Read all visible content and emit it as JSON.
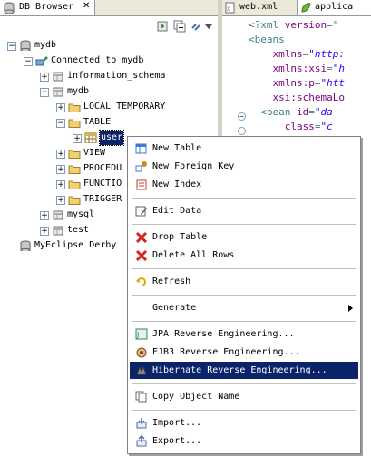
{
  "view": {
    "title": "DB Browser",
    "close_glyph": "✕"
  },
  "tree": [
    {
      "label": "mydb",
      "indent": 0,
      "icon": "database-icon",
      "expander": "−"
    },
    {
      "label": "Connected to mydb",
      "indent": 1,
      "icon": "connection-icon",
      "expander": "−"
    },
    {
      "label": "information_schema",
      "indent": 2,
      "icon": "schema-icon",
      "expander": "+"
    },
    {
      "label": "mydb",
      "indent": 2,
      "icon": "schema-icon",
      "expander": "−"
    },
    {
      "label": "LOCAL TEMPORARY",
      "indent": 3,
      "icon": "folder-icon",
      "expander": "+"
    },
    {
      "label": "TABLE",
      "indent": 3,
      "icon": "folder-icon",
      "expander": "−"
    },
    {
      "label": "user",
      "indent": 4,
      "icon": "table-icon",
      "expander": "+",
      "selected": true
    },
    {
      "label": "VIEW",
      "indent": 3,
      "icon": "folder-icon",
      "expander": "+"
    },
    {
      "label": "PROCEDU",
      "indent": 3,
      "icon": "folder-icon",
      "expander": "+"
    },
    {
      "label": "FUNCTIO",
      "indent": 3,
      "icon": "folder-icon",
      "expander": "+"
    },
    {
      "label": "TRIGGER",
      "indent": 3,
      "icon": "folder-icon",
      "expander": "+"
    },
    {
      "label": "mysql",
      "indent": 2,
      "icon": "schema-icon",
      "expander": "+"
    },
    {
      "label": "test",
      "indent": 2,
      "icon": "schema-icon",
      "expander": "+"
    },
    {
      "label": "MyEclipse Derby",
      "indent": 0,
      "icon": "database-icon",
      "expander": ""
    }
  ],
  "editor": {
    "tab_inactive": "web.xml",
    "tab_active": "applica",
    "lines": [
      {
        "parts": [
          [
            "tag",
            "<?xml "
          ],
          [
            "attr",
            "version"
          ],
          [
            "tag",
            "=\""
          ]
        ]
      },
      {
        "parts": [
          [
            "tag",
            "<beans"
          ]
        ]
      },
      {
        "parts": [
          [
            "attr",
            "    xmlns"
          ],
          [
            "tag",
            "="
          ],
          [
            "val",
            "\"http:"
          ]
        ]
      },
      {
        "parts": [
          [
            "attr",
            "    xmlns:xsi"
          ],
          [
            "tag",
            "="
          ],
          [
            "val",
            "\"h"
          ]
        ]
      },
      {
        "parts": [
          [
            "attr",
            "    xmlns:p"
          ],
          [
            "tag",
            "="
          ],
          [
            "val",
            "\"htt"
          ]
        ]
      },
      {
        "parts": [
          [
            "attr",
            "    xsi:schemaLo"
          ]
        ]
      },
      {
        "parts": [
          [
            "tag",
            "  <bean "
          ],
          [
            "attr",
            "id"
          ],
          [
            "tag",
            "="
          ],
          [
            "val",
            "\"da"
          ]
        ]
      },
      {
        "parts": [
          [
            "attr",
            "      class"
          ],
          [
            "tag",
            "="
          ],
          [
            "val",
            "\"c"
          ]
        ]
      }
    ]
  },
  "menu": {
    "items": [
      {
        "label": "New Table",
        "icon": "new-table-icon",
        "color": "#3a7bd5"
      },
      {
        "label": "New Foreign Key",
        "icon": "foreign-key-icon",
        "color": "#d08a1e"
      },
      {
        "label": "New Index",
        "icon": "index-icon",
        "color": "#c0392b"
      },
      {
        "sep": true
      },
      {
        "label": "Edit Data",
        "icon": "edit-data-icon",
        "color": "#556b2f"
      },
      {
        "sep": true
      },
      {
        "label": "Drop Table",
        "icon": "drop-icon",
        "color": "#d9261c"
      },
      {
        "label": "Delete All Rows",
        "icon": "delete-rows-icon",
        "color": "#d9261c"
      },
      {
        "sep": true
      },
      {
        "label": "Refresh",
        "icon": "refresh-icon",
        "color": "#e0a800"
      },
      {
        "sep": true
      },
      {
        "label": "Generate",
        "icon": "",
        "submenu": true
      },
      {
        "sep": true
      },
      {
        "label": "JPA Reverse Engineering...",
        "icon": "jpa-icon",
        "color": "#2e8b57"
      },
      {
        "label": "EJB3 Reverse Engineering...",
        "icon": "ejb3-icon",
        "color": "#8b4513"
      },
      {
        "label": "Hibernate Reverse Engineering...",
        "icon": "hibernate-icon",
        "color": "#8a8a8a",
        "selected": true
      },
      {
        "sep": true
      },
      {
        "label": "Copy Object Name",
        "icon": "copy-icon",
        "color": "#6a6a6a"
      },
      {
        "sep": true
      },
      {
        "label": "Import...",
        "icon": "import-icon",
        "color": "#4a6fa5"
      },
      {
        "label": "Export...",
        "icon": "export-icon",
        "color": "#4a6fa5"
      }
    ]
  }
}
